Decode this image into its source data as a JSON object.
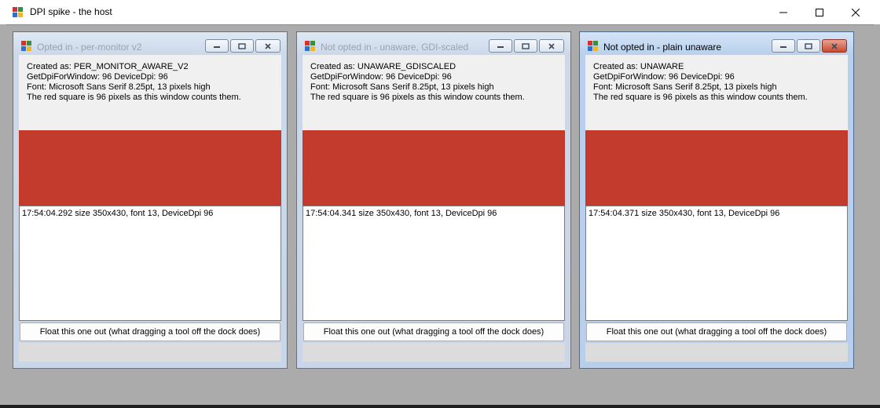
{
  "host": {
    "title": "DPI spike - the host"
  },
  "windows": [
    {
      "title": "Opted in - per-monitor v2",
      "active": false,
      "info": [
        "Created as: PER_MONITOR_AWARE_V2",
        "GetDpiForWindow: 96   DeviceDpi: 96",
        "Font: Microsoft Sans Serif 8.25pt, 13 pixels high",
        "The red square is 96 pixels as this window counts them."
      ],
      "log": [
        "17:54:04.292  size 350x430, font 13, DeviceDpi 96"
      ],
      "float_label": "Float this one out (what dragging a tool off the dock does)"
    },
    {
      "title": "Not opted in - unaware, GDI-scaled",
      "active": false,
      "info": [
        "Created as: UNAWARE_GDISCALED",
        "GetDpiForWindow: 96   DeviceDpi: 96",
        "Font: Microsoft Sans Serif 8.25pt, 13 pixels high",
        "The red square is 96 pixels as this window counts them."
      ],
      "log": [
        "17:54:04.341  size 350x430, font 13, DeviceDpi 96"
      ],
      "float_label": "Float this one out (what dragging a tool off the dock does)"
    },
    {
      "title": "Not opted in - plain unaware",
      "active": true,
      "info": [
        "Created as: UNAWARE",
        "GetDpiForWindow: 96   DeviceDpi: 96",
        "Font: Microsoft Sans Serif 8.25pt, 13 pixels high",
        "The red square is 96 pixels as this window counts them."
      ],
      "log": [
        "17:54:04.371  size 350x430, font 13, DeviceDpi 96"
      ],
      "float_label": "Float this one out (what dragging a tool off the dock does)"
    }
  ],
  "colors": {
    "red_square": "#c23b2d",
    "mdi_background": "#ababab"
  },
  "icons": [
    "app-icon",
    "minimize-icon",
    "maximize-icon",
    "close-icon"
  ]
}
